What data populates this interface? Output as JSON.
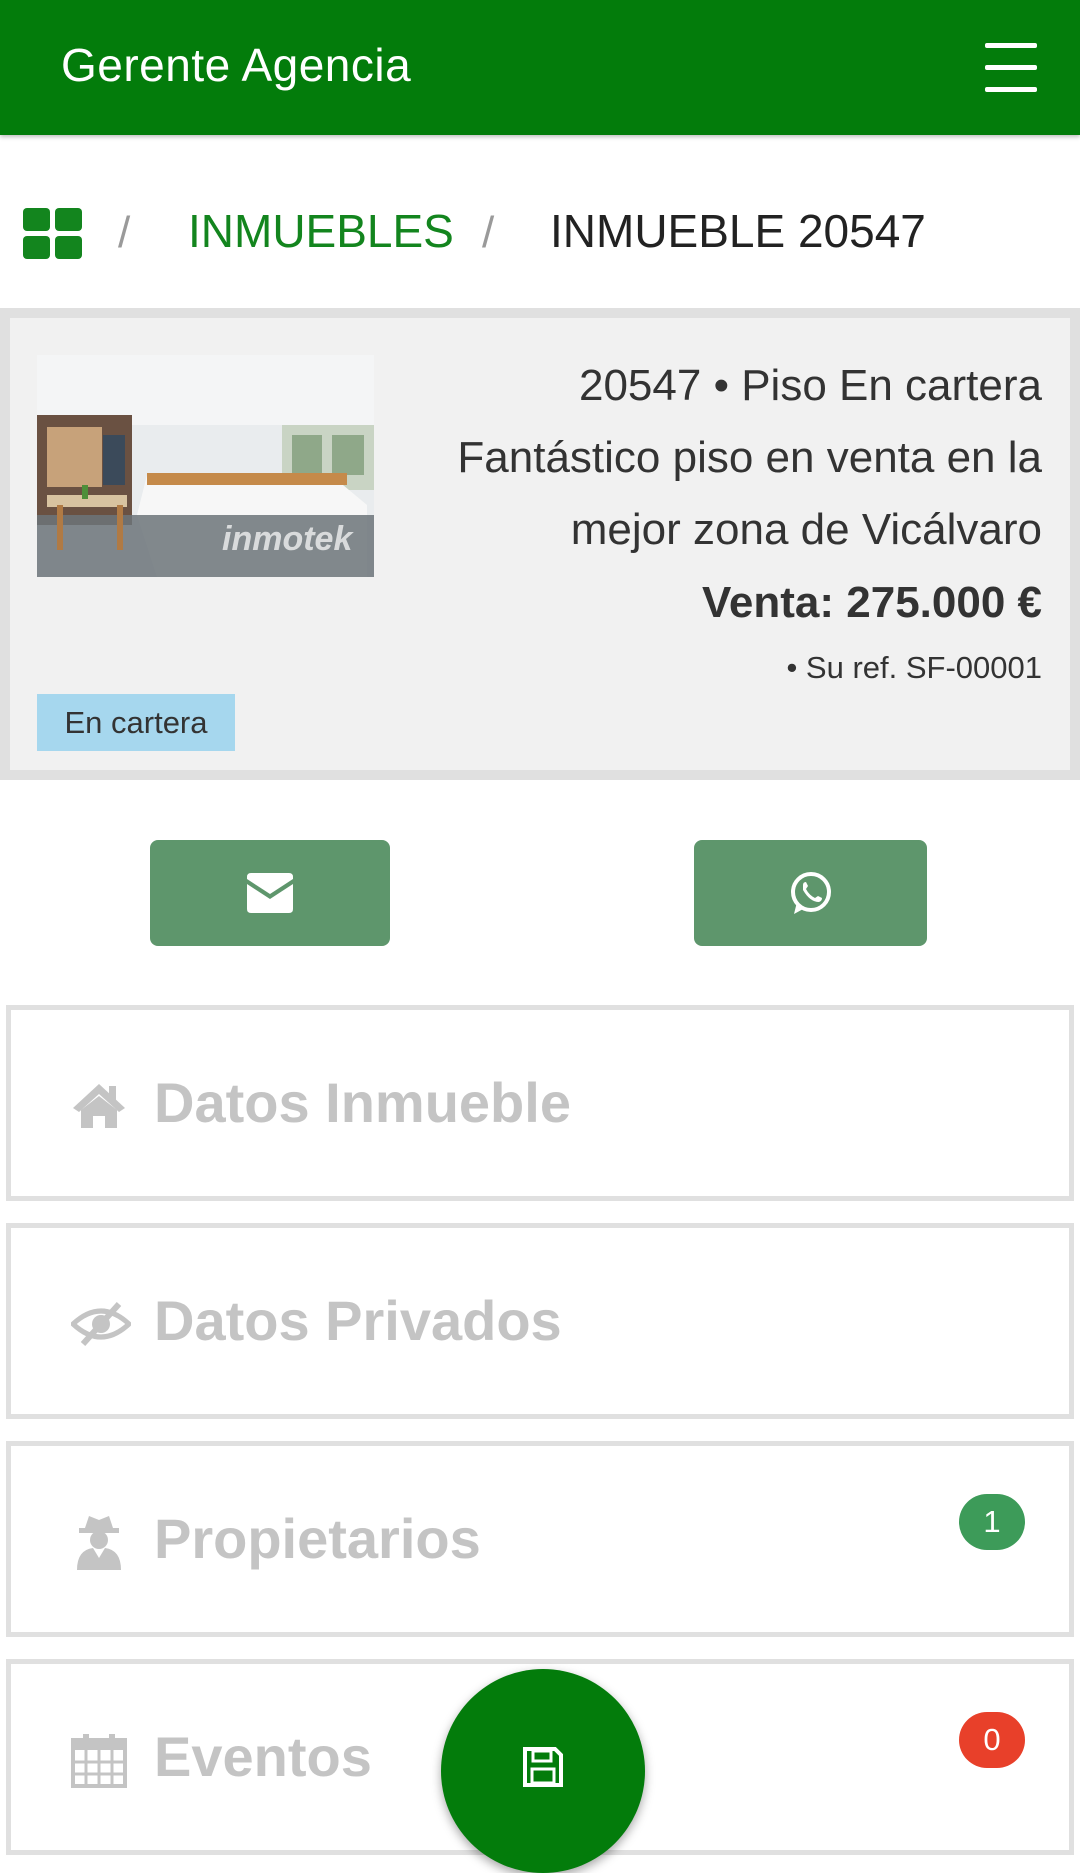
{
  "appbar": {
    "title": "Gerente Agencia",
    "menu_icon": "hamburger-menu-icon"
  },
  "breadcrumb": {
    "home_icon": "grid-dashboard-icon",
    "separator": "/",
    "section": "INMUEBLES",
    "current": "INMUEBLE 20547"
  },
  "property": {
    "heading": "20547 • Piso En cartera Fantástico piso en venta en la mejor zona de Vicálvaro",
    "price": "Venta: 275.000 €",
    "reference": "• Su ref. SF-00001",
    "status_badge": "En cartera",
    "photo_watermark": "inmotek"
  },
  "actions": {
    "email_icon": "envelope-icon",
    "whatsapp_icon": "whatsapp-icon"
  },
  "sections": [
    {
      "label": "Datos Inmueble",
      "icon": "home-icon",
      "count": null
    },
    {
      "label": "Datos Privados",
      "icon": "eye-slash-icon",
      "count": null
    },
    {
      "label": "Propietarios",
      "icon": "user-secret-icon",
      "count": "1"
    },
    {
      "label": "Eventos",
      "icon": "calendar-icon",
      "count": "0"
    }
  ],
  "fab": {
    "icon": "floppy-disk-save-icon"
  },
  "colors": {
    "primary": "#037c0b",
    "action_button": "#5e966c",
    "link": "#13851e",
    "status_badge": "#a6d7ee",
    "badge_green": "#3d9b59",
    "badge_red": "#e8402a",
    "section_text": "#c4c4c4"
  }
}
